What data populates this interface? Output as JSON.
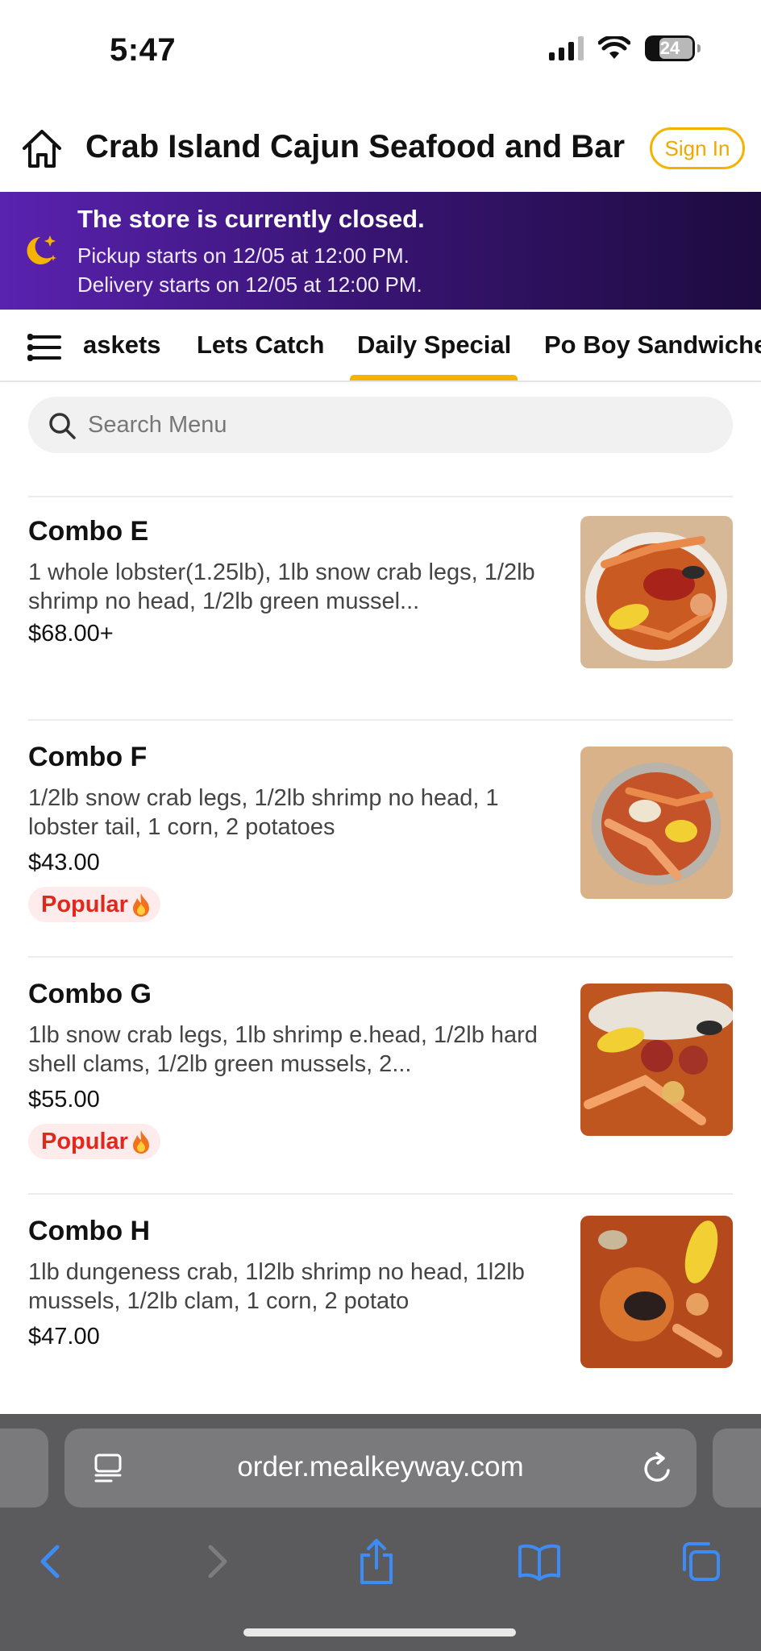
{
  "status_bar": {
    "time": "5:47",
    "battery": "24"
  },
  "header": {
    "store_name": "Crab Island Cajun Seafood and Bar",
    "sign_in": "Sign In"
  },
  "banner": {
    "title": "The store is currently closed.",
    "pickup": "Pickup starts on 12/05 at 12:00 PM.",
    "delivery": "Delivery starts on 12/05 at 12:00 PM."
  },
  "categories": {
    "tabs": [
      "askets",
      "Lets Catch",
      "Daily Special",
      "Po Boy Sandwiche"
    ],
    "active": "Daily Special"
  },
  "search": {
    "placeholder": "Search Menu"
  },
  "items": [
    {
      "name": "Combo E",
      "description": "1 whole lobster(1.25lb), 1lb snow crab legs, 1/2lb shrimp no head, 1/2lb green mussel...",
      "price": "$68.00+",
      "popular": false
    },
    {
      "name": "Combo F",
      "description": "1/2lb snow crab legs, 1/2lb shrimp no head, 1 lobster tail, 1 corn, 2 potatoes",
      "price": "$43.00",
      "popular": true,
      "badge": "Popular"
    },
    {
      "name": "Combo G",
      "description": "1lb snow crab legs, 1lb shrimp e.head, 1/2lb hard shell clams, 1/2lb green mussels, 2...",
      "price": "$55.00",
      "popular": true,
      "badge": "Popular"
    },
    {
      "name": "Combo H",
      "description": "1lb dungeness crab, 1l2lb shrimp no head, 1l2lb mussels, 1/2lb clam, 1 corn, 2 potato",
      "price": "$47.00",
      "popular": false
    }
  ],
  "browser": {
    "url": "order.mealkeyway.com"
  },
  "colors": {
    "accent": "#f5b301",
    "banner_start": "#5a22b0",
    "banner_end": "#1e0b40",
    "popular_text": "#e0291c",
    "popular_bg": "#fdeceb",
    "browser_icon": "#3d8cf5"
  }
}
